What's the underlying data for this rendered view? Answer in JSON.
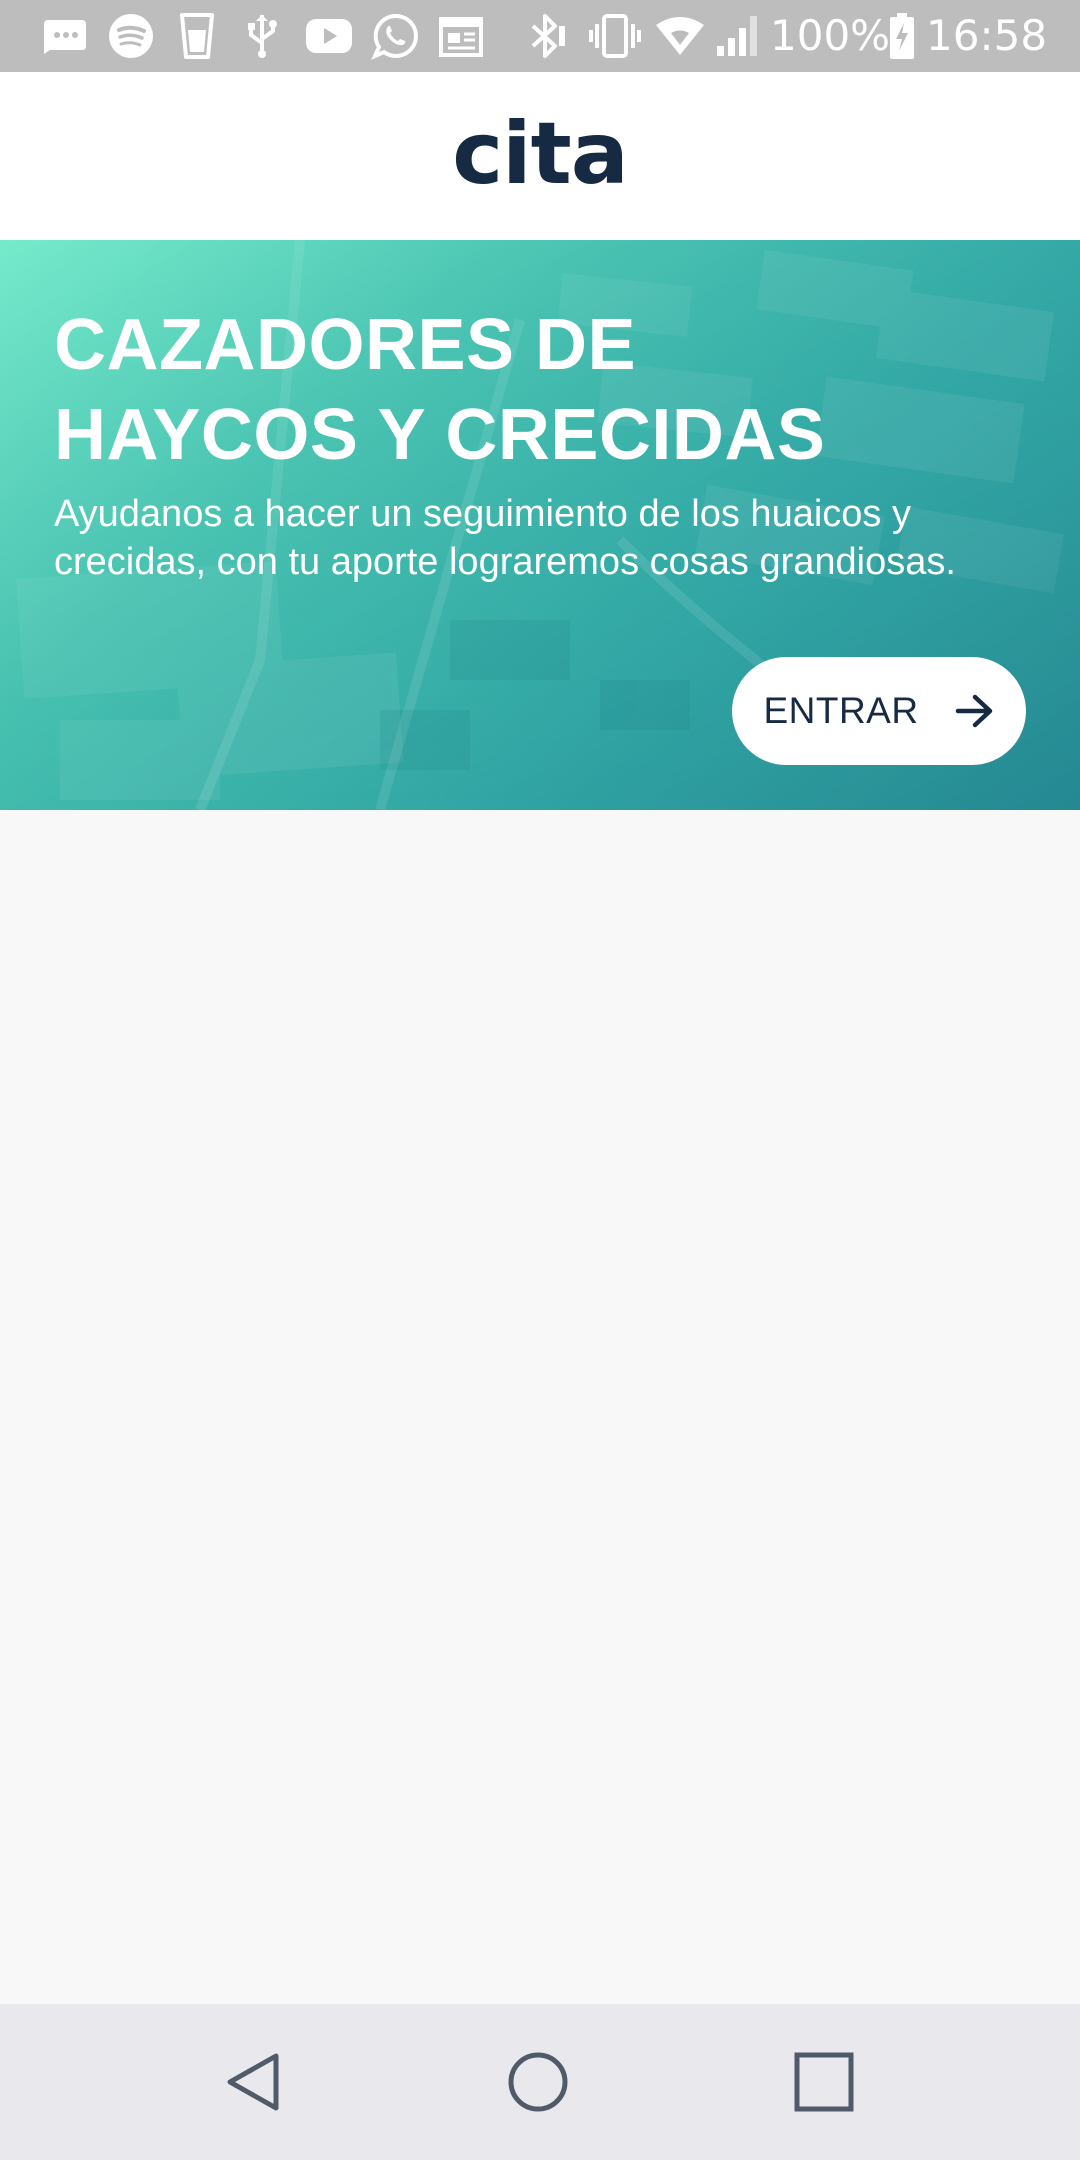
{
  "status_bar": {
    "battery_percent": "100%",
    "time": "16:58",
    "icons": [
      "message-icon",
      "spotify-icon",
      "glass-icon",
      "usb-icon",
      "youtube-icon",
      "whatsapp-icon",
      "calendar-icon",
      "bluetooth-icon",
      "vibrate-icon",
      "wifi-icon",
      "signal-icon",
      "battery-icon"
    ]
  },
  "header": {
    "logo": "cita"
  },
  "hero": {
    "title_lines": [
      "CAZADORES DE",
      "HAYCOS Y CRECIDAS"
    ],
    "subtitle_lines": [
      "Ayudanos a hacer un seguimiento de los huaicos y",
      "crecidas, con tu aporte lograremos cosas grandiosas."
    ],
    "button_label": "ENTRAR",
    "button_icon": "arrow-right-icon"
  },
  "nav_bar": {
    "buttons": [
      "back-icon",
      "home-icon",
      "recents-icon"
    ]
  },
  "colors": {
    "status_bar_bg": "#bdbdbd",
    "brand_dark": "#172a43",
    "hero_teal": "#33a8a6",
    "content_bg": "#f8f8f8",
    "nav_bar_bg": "#e9e9ed",
    "nav_icon": "#505a69"
  }
}
